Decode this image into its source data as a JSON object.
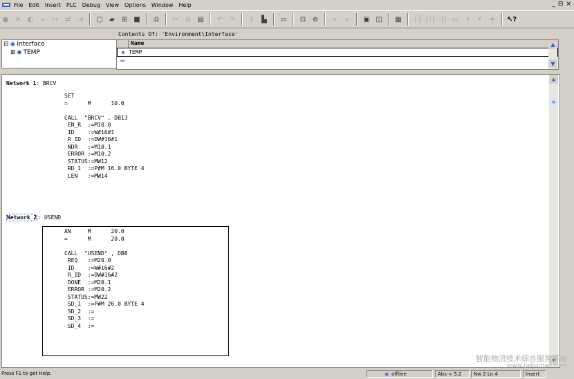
{
  "menubar": {
    "items": [
      "File",
      "Edit",
      "Insert",
      "PLC",
      "Debug",
      "View",
      "Options",
      "Window",
      "Help"
    ],
    "window_controls": [
      "_",
      "⊟",
      "×"
    ]
  },
  "objects": {
    "contents_label": "Contents Of: 'Environment\\Interface'",
    "tree": [
      {
        "expander": "⊟",
        "label": "Interface"
      },
      {
        "expander": "⊞",
        "label": "TEMP"
      }
    ],
    "list_header": "Name",
    "list_rows": [
      "TEMP",
      ""
    ]
  },
  "editor": {
    "network1": {
      "title_bold": "Network 1",
      "title_rest": ": BRCV",
      "lines": [
        "SET",
        "=      M      10.0",
        "",
        "CALL  \"BRCV\" , DB13",
        " EN_R  :=M10.0",
        " ID    :=W#16#1",
        " R_ID  :=DW#16#1",
        " NDR   :=M10.1",
        " ERROR :=M10.2",
        " STATUS:=MW12",
        " RD_1  :=P#M 16.0 BYTE 4",
        " LEN   :=MW14"
      ]
    },
    "network2": {
      "title_bold": "Network 2",
      "title_rest": ": USEND",
      "lines": [
        "AN     M      20.0",
        "=      M      20.0",
        "",
        "CALL  \"USEND\" , DB8",
        " REQ   :=M20.0",
        " ID    :=W#16#2",
        " R_ID  :=DW#16#2",
        " DONE  :=M20.1",
        " ERROR :=M20.2",
        " STATUS:=MW22",
        " SD_1  :=P#M 26.0 BYTE 4",
        " SD_2  :=",
        " SD_3  :=",
        " SD_4  :="
      ]
    }
  },
  "statusbar": {
    "help": "Press F1 to get Help.",
    "mode": "offline",
    "abs": "Abs < 5.2",
    "pos": "Nw 2 Ln 4",
    "insert": "Insert"
  },
  "watermark": {
    "line1": "智能物流技术综合服务平台",
    "line2": "www.jiekumao.com"
  }
}
